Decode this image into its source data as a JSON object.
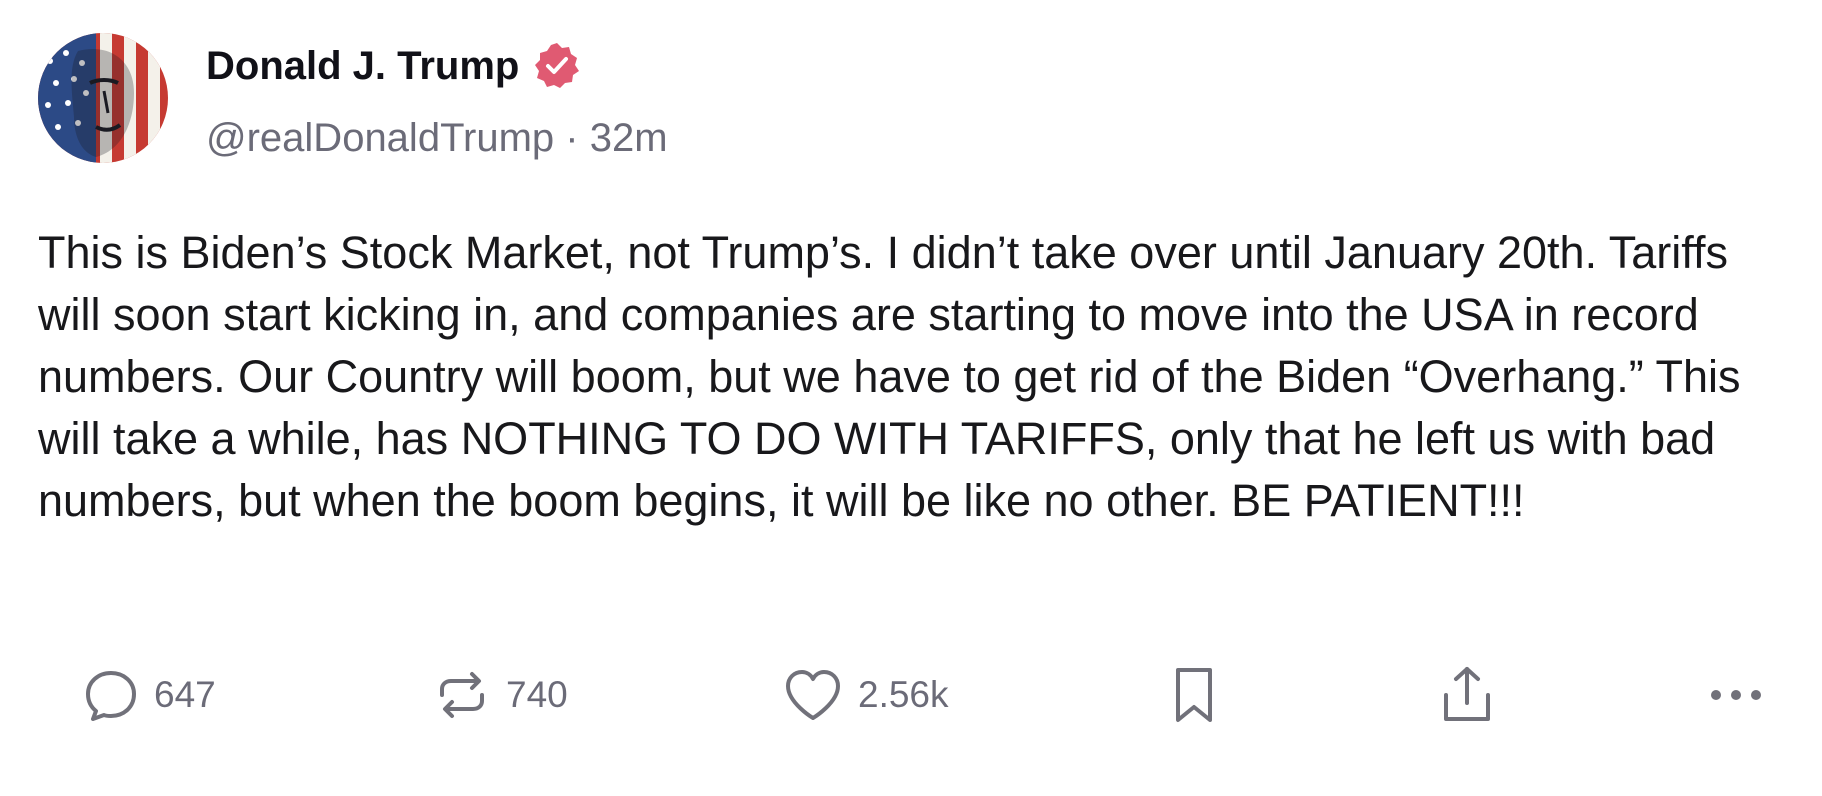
{
  "author": {
    "display_name": "Donald J. Trump",
    "verified_icon": "verified-badge-icon",
    "verified_color": "#e05a72",
    "handle": "@realDonaldTrump",
    "separator": "·",
    "timestamp": "32m"
  },
  "post": {
    "text": "This is Biden’s Stock Market, not Trump’s. I didn’t take over until January 20th. Tariffs will soon start kicking in, and companies are starting to move into the USA in record numbers. Our Country will boom, but we have to get rid of the Biden “Overhang.” This will take a while, has NOTHING TO DO WITH TARIFFS, only that he left us with bad numbers, but when the boom begins, it will be like no other. BE PATIENT!!!"
  },
  "actions": {
    "reply": {
      "icon": "reply-icon",
      "count": "647"
    },
    "retruth": {
      "icon": "repost-icon",
      "count": "740"
    },
    "like": {
      "icon": "heart-icon",
      "count": "2.56k"
    },
    "bookmark": {
      "icon": "bookmark-icon"
    },
    "share": {
      "icon": "share-icon"
    },
    "more": {
      "icon": "more-icon"
    }
  },
  "colors": {
    "text": "#18181b",
    "muted": "#6b6b78",
    "icon": "#71717a",
    "background": "#ffffff"
  }
}
